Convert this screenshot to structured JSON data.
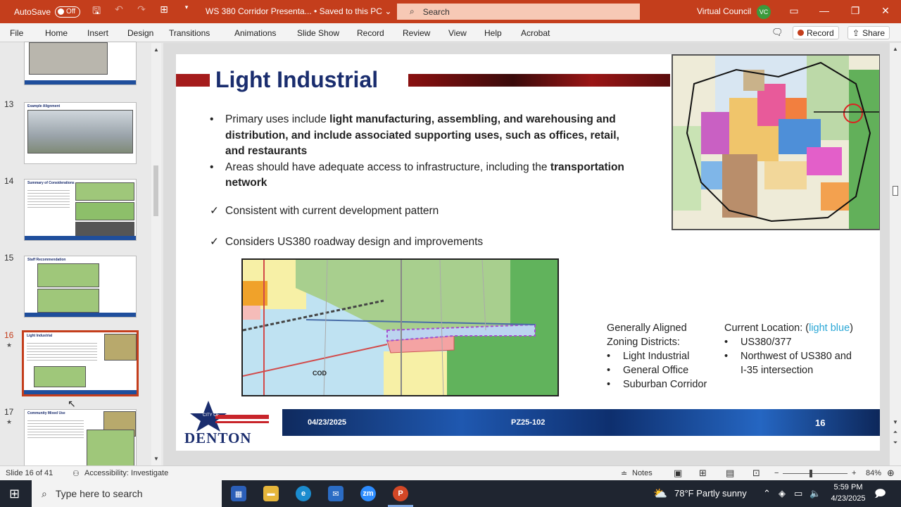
{
  "titlebar": {
    "autosave_label": "AutoSave",
    "autosave_state": "Off",
    "doc_title": "WS 380 Corridor Presenta... • Saved to this PC",
    "search_placeholder": "Search",
    "user_name": "Virtual Council",
    "user_initials": "VC"
  },
  "ribbon": {
    "tabs": [
      "File",
      "Home",
      "Insert",
      "Design",
      "Transitions",
      "Animations",
      "Slide Show",
      "Record",
      "Review",
      "View",
      "Help",
      "Acrobat"
    ],
    "record_btn": "Record",
    "share_btn": "Share"
  },
  "thumbnails": [
    {
      "num": "",
      "title": ""
    },
    {
      "num": "13",
      "title": "Example Alignment"
    },
    {
      "num": "14",
      "title": "Summary of Considerations"
    },
    {
      "num": "15",
      "title": "Staff Recommendation"
    },
    {
      "num": "16",
      "title": "Light Industrial"
    },
    {
      "num": "17",
      "title": "Community Mixed Use"
    }
  ],
  "slide": {
    "title": "Light Industrial",
    "bullet1_pre": "Primary uses include ",
    "bullet1_bold": "light manufacturing, assembling, and warehousing and distribution, and include associated supporting uses, such as offices, retail, and restaurants",
    "bullet2_pre": "Areas should have adequate access to infrastructure, including the ",
    "bullet2_bold": "transportation network",
    "check1": "Consistent with current development pattern",
    "check2": "Considers US380 roadway design and improvements",
    "aligned_heading1": "Generally Aligned",
    "aligned_heading2": "Zoning Districts:",
    "aligned_items": [
      "Light Industrial",
      "General Office",
      "Suburban Corridor"
    ],
    "curloc_pre": "Current Location: (",
    "curloc_blue": "light blue",
    "curloc_post": ")",
    "curloc_items": [
      "US380/377",
      "Northwest of US380 and",
      "I-35 intersection"
    ],
    "map_label": "COD",
    "logo_city": "DENTON",
    "logo_small": "CITY OF",
    "footer_date": "04/23/2025",
    "footer_code": "PZ25-102",
    "footer_page": "16"
  },
  "statusbar": {
    "slide_count": "Slide 16 of 41",
    "accessibility": "Accessibility: Investigate",
    "notes": "Notes",
    "zoom": "84%"
  },
  "taskbar": {
    "search_placeholder": "Type here to search",
    "weather": "78°F  Partly sunny",
    "time": "5:59 PM",
    "date": "4/23/2025"
  },
  "colors": {
    "accent": "#c43e1c",
    "title_blue": "#1a2d6e",
    "light_blue": "#2aa7d6"
  }
}
